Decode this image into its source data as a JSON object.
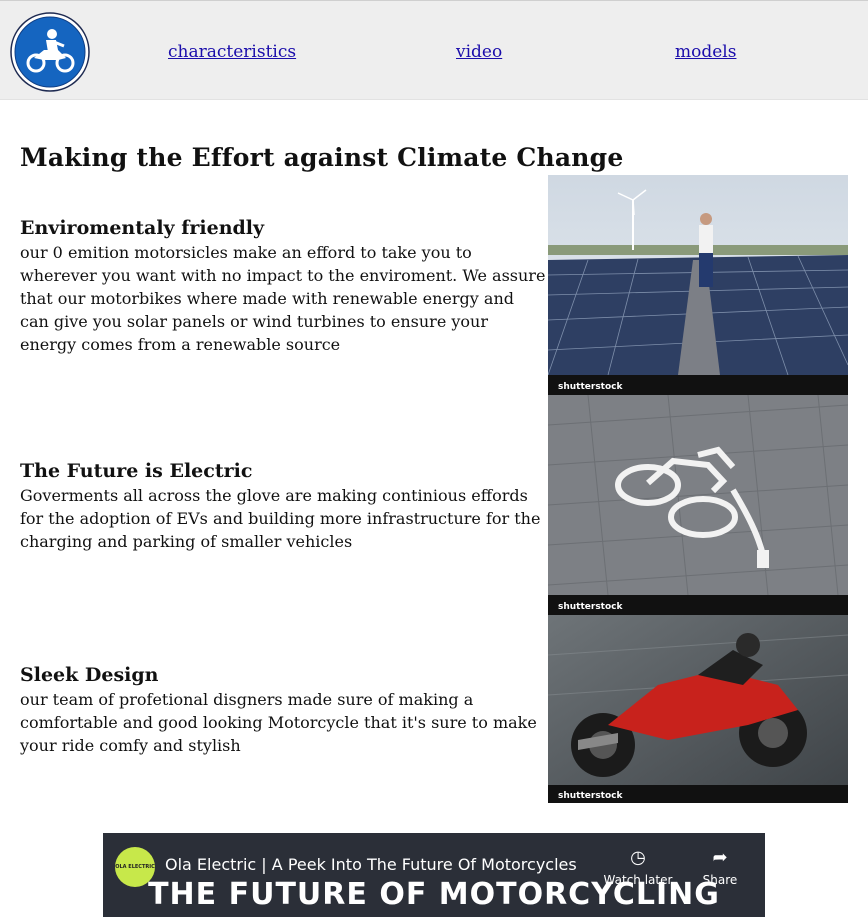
{
  "nav": {
    "links": [
      "characteristics",
      "video",
      "models"
    ]
  },
  "main": {
    "title": "Making the Effort against Climate Change",
    "sections": [
      {
        "heading": "Enviromentaly friendly",
        "text": "our 0 emition motorsicles make an efford to take you to wherever you want with no impact to the enviroment. We assure that our motorbikes where made with renewable energy and can give you solar panels or wind turbines to ensure your energy comes from a renewable source"
      },
      {
        "heading": "The Future is Electric",
        "text": "Goverments all across the glove are making continious effords for the adoption of EVs and building more infrastructure for the charging and parking of smaller vehicles"
      },
      {
        "heading": "Sleek Design",
        "text": "our team of profetional disgners made sure of making a comfortable and good looking Motorcycle that it's sure to make your ride comfy and stylish"
      }
    ],
    "images": [
      {
        "watermark": "shutterstock"
      },
      {
        "watermark": "shutterstock"
      },
      {
        "watermark": "shutterstock"
      }
    ]
  },
  "video": {
    "channel_logo_text": "OLA ELECTRIC",
    "title": "Ola Electric | A Peek Into The Future Of Motorcycles",
    "thumbnail_text": "THE FUTURE OF MOTORCYCLING",
    "watch_later_label": "Watch later",
    "share_label": "Share"
  },
  "colors": {
    "nav_bg": "#eeeeee",
    "link": "#1a0dab",
    "logo_blue": "#1565c0",
    "video_bg": "#2b2f38"
  }
}
